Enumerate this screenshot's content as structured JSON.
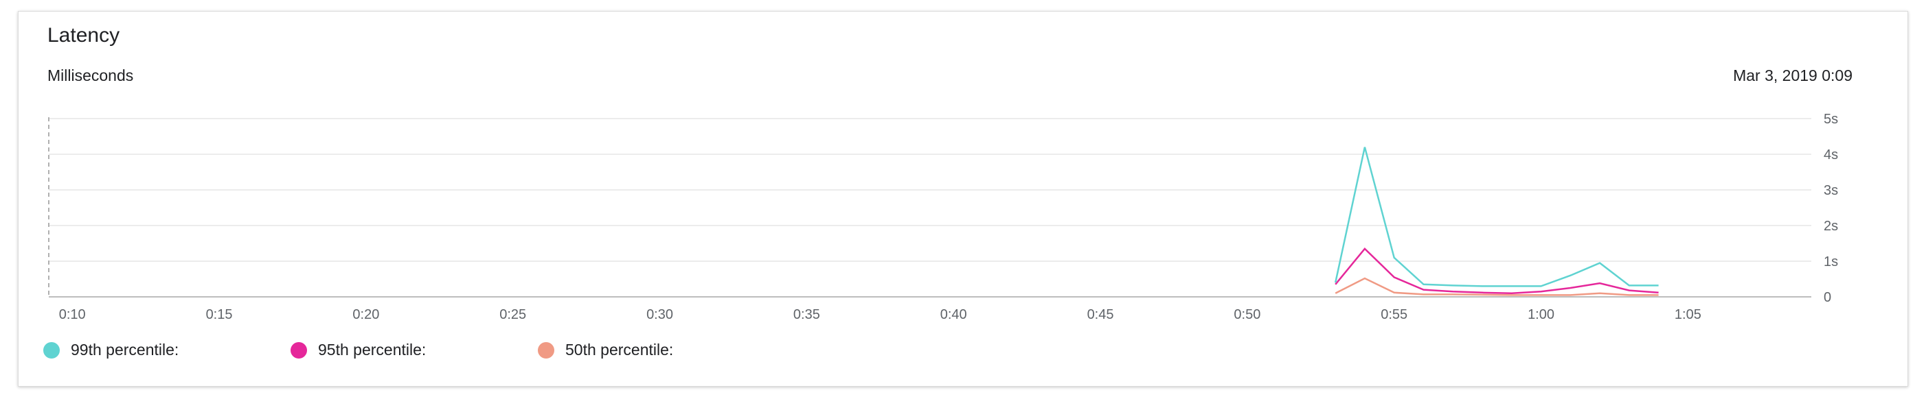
{
  "panel": {
    "title": "Latency",
    "subtitle": "Milliseconds",
    "timestamp": "Mar 3, 2019 0:09"
  },
  "chart_data": {
    "type": "line",
    "title": "Latency",
    "ylabel": "Milliseconds",
    "x_ticks": [
      "0:10",
      "0:15",
      "0:20",
      "0:25",
      "0:30",
      "0:35",
      "0:40",
      "0:45",
      "0:50",
      "0:55",
      "1:00",
      "1:05"
    ],
    "x_tick_minutes": [
      10,
      15,
      20,
      25,
      30,
      35,
      40,
      45,
      50,
      55,
      60,
      65
    ],
    "xlim_minutes": [
      9.2,
      69.2
    ],
    "y_ticks": [
      "0",
      "1s",
      "2s",
      "3s",
      "4s",
      "5s"
    ],
    "y_tick_values": [
      0,
      1,
      2,
      3,
      4,
      5
    ],
    "ylim": [
      0,
      5
    ],
    "grid": true,
    "legend_position": "bottom-left",
    "series": [
      {
        "name": "99th percentile:",
        "color": "#5fd3d1",
        "x": [
          "0:53",
          "0:54",
          "0:55",
          "0:56",
          "0:57",
          "0:58",
          "0:59",
          "1:00",
          "1:01",
          "1:02",
          "1:03",
          "1:04"
        ],
        "x_minutes": [
          53,
          54,
          55,
          56,
          57,
          58,
          59,
          60,
          61,
          62,
          63,
          64
        ],
        "values": [
          0.4,
          4.2,
          1.1,
          0.35,
          0.32,
          0.3,
          0.3,
          0.3,
          0.6,
          0.95,
          0.32,
          0.32
        ]
      },
      {
        "name": "95th percentile:",
        "color": "#e5279a",
        "x": [
          "0:53",
          "0:54",
          "0:55",
          "0:56",
          "0:57",
          "0:58",
          "0:59",
          "1:00",
          "1:01",
          "1:02",
          "1:03",
          "1:04"
        ],
        "x_minutes": [
          53,
          54,
          55,
          56,
          57,
          58,
          59,
          60,
          61,
          62,
          63,
          64
        ],
        "values": [
          0.35,
          1.35,
          0.55,
          0.2,
          0.15,
          0.12,
          0.1,
          0.15,
          0.25,
          0.38,
          0.18,
          0.12
        ]
      },
      {
        "name": "50th percentile:",
        "color": "#f09a84",
        "x": [
          "0:53",
          "0:54",
          "0:55",
          "0:56",
          "0:57",
          "0:58",
          "0:59",
          "1:00",
          "1:01",
          "1:02",
          "1:03",
          "1:04"
        ],
        "x_minutes": [
          53,
          54,
          55,
          56,
          57,
          58,
          59,
          60,
          61,
          62,
          63,
          64
        ],
        "values": [
          0.1,
          0.52,
          0.12,
          0.07,
          0.07,
          0.06,
          0.05,
          0.05,
          0.05,
          0.1,
          0.05,
          0.05
        ]
      }
    ]
  }
}
